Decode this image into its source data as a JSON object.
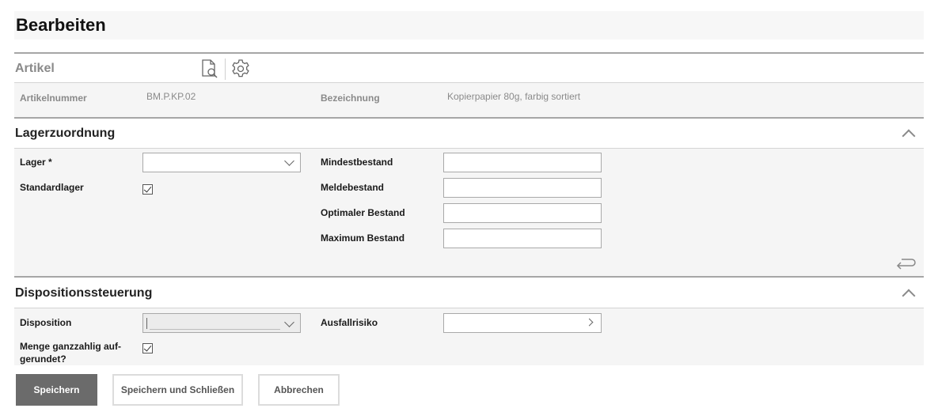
{
  "page": {
    "title": "Bearbeiten"
  },
  "artikel": {
    "heading": "Artikel",
    "fields": [
      {
        "label": "Artikelnummer",
        "value": "BM.P.KP.02"
      },
      {
        "label": "Bezeichnung",
        "value": "Kopierpapier 80g, farbig sortiert"
      }
    ]
  },
  "lagerzuordnung": {
    "heading": "Lagerzuordnung",
    "lager_label": "Lager *",
    "lager_value": "",
    "standardlager_label": "Standardlager",
    "standardlager_checked": true,
    "mindestbestand_label": "Mindestbestand",
    "mindestbestand_value": "",
    "meldebestand_label": "Meldebestand",
    "meldebestand_value": "",
    "optimal_label": "Optimaler Bestand",
    "optimal_value": "",
    "maximum_label": "Maximum Bestand",
    "maximum_value": ""
  },
  "disposition": {
    "heading": "Dispositionssteuerung",
    "disposition_label": "Disposition",
    "disposition_value": "",
    "ausfall_label": "Ausfallrisiko",
    "ausfall_value": "",
    "menge_label_line1": "Menge ganzzahlig auf-",
    "menge_label_line2": "gerundet?",
    "menge_checked": true
  },
  "buttons": {
    "save": "Speichern",
    "save_close": "Speichern und Schließen",
    "cancel": "Abbrechen"
  }
}
